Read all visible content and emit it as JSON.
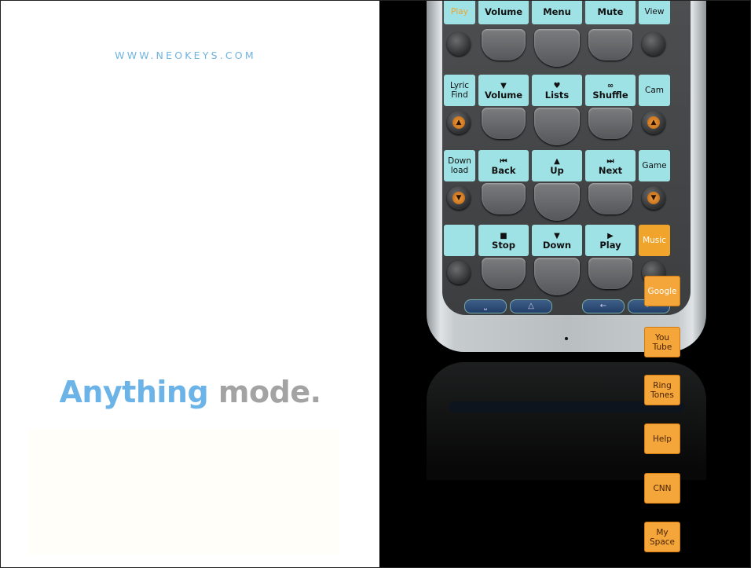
{
  "left": {
    "url": "WWW.NEOKEYS.COM",
    "headline_highlight": "Anything",
    "headline_rest": "mode."
  },
  "remote": {
    "rows": [
      {
        "left_label": "Play",
        "keys": [
          {
            "icon": "",
            "label": "Volume"
          },
          {
            "icon": "",
            "label": "Menu"
          },
          {
            "icon": "",
            "label": "Mute"
          }
        ],
        "right_label": "View"
      },
      {
        "left_label": "Lyric Find",
        "keys": [
          {
            "icon": "▼",
            "label": "Volume"
          },
          {
            "icon": "♥",
            "label": "Lists"
          },
          {
            "icon": "∞",
            "label": "Shuffle"
          }
        ],
        "right_label": "Cam"
      },
      {
        "left_label": "Down load",
        "keys": [
          {
            "icon": "⏮",
            "label": "Back"
          },
          {
            "icon": "▲",
            "label": "Up"
          },
          {
            "icon": "⏭",
            "label": "Next"
          }
        ],
        "right_label": "Game"
      },
      {
        "left_label": "",
        "keys": [
          {
            "icon": "■",
            "label": "Stop"
          },
          {
            "icon": "▼",
            "label": "Down"
          },
          {
            "icon": "▶",
            "label": "Play"
          }
        ],
        "right_label": "Music"
      }
    ],
    "side_labels": [
      "Google",
      "You Tube",
      "Ring Tones",
      "Help",
      "CNN",
      "My Space"
    ]
  },
  "colors": {
    "accent_blue": "#6cb4e8",
    "key_cyan": "#9fe2e6",
    "key_orange": "#f1a42c",
    "background_right": "#000000"
  }
}
